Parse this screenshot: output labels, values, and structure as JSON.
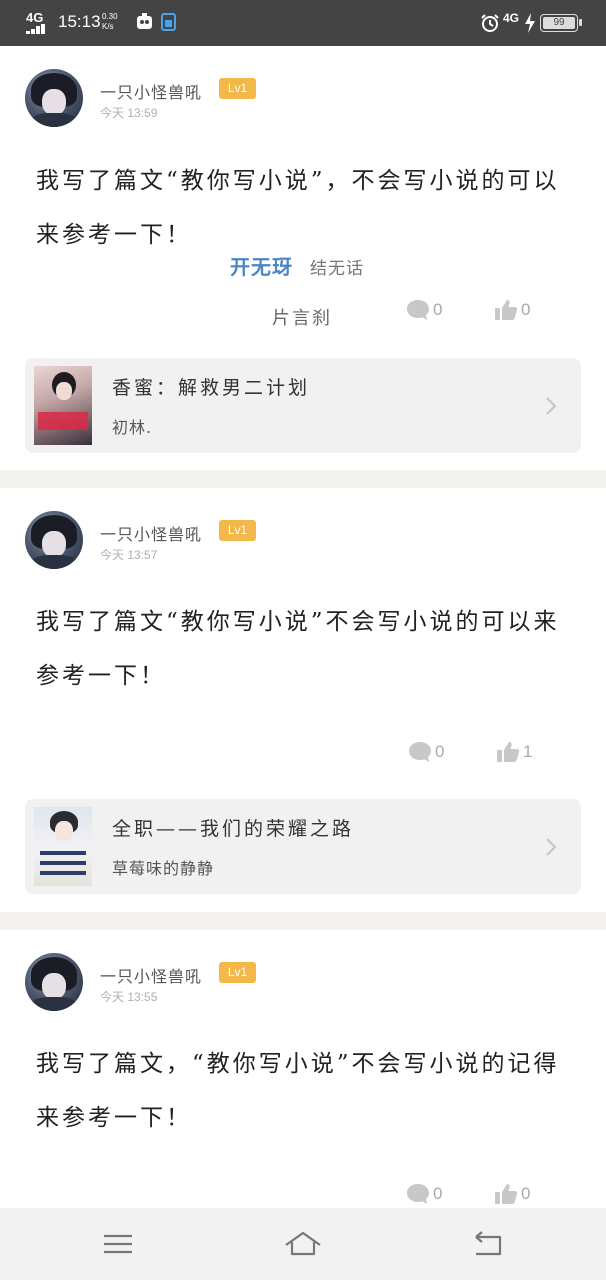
{
  "status_bar": {
    "network": "4G",
    "time": "15:13",
    "speed_value": "0.30",
    "speed_unit": "K/s",
    "network_right": "4G",
    "battery": "99"
  },
  "posts": [
    {
      "username": "一只小怪兽吼",
      "level": "Lv1",
      "date": "今天 13:59",
      "content": "我写了篇文“教你写小说”，不会写小说的可以来参考一下！",
      "comments": "0",
      "likes": "0",
      "book": {
        "title": "香蜜：解救男二计划",
        "author": "初林."
      }
    },
    {
      "username": "一只小怪兽吼",
      "level": "Lv1",
      "date": "今天 13:57",
      "content": "我写了篇文“教你写小说”不会写小说的可以来参考一下！",
      "comments": "0",
      "likes": "1",
      "book": {
        "title": "全职——我们的荣耀之路",
        "author": "草莓味的静静"
      }
    },
    {
      "username": "一只小怪兽吼",
      "level": "Lv1",
      "date": "今天 13:55",
      "content": "我写了篇文，“教你写小说”不会写小说的记得来参考一下！",
      "comments": "0",
      "likes": "0"
    }
  ],
  "watermark": {
    "part1": "开无玡",
    "part2": "结无话",
    "part3": "片言刹"
  },
  "icons": {
    "comment": "comment-bubble-icon",
    "like": "thumbs-up-icon",
    "chevron": "chevron-right-icon",
    "menu": "menu-icon",
    "home": "home-icon",
    "back": "back-icon"
  }
}
